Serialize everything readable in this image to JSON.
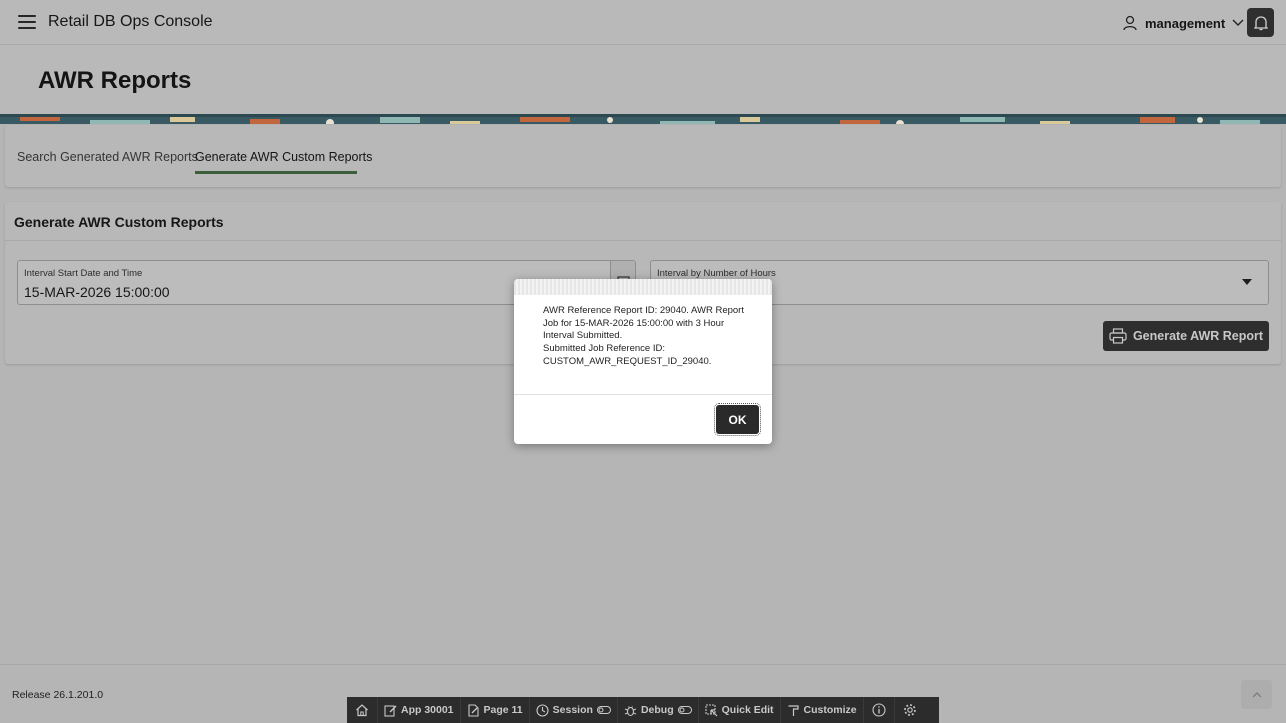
{
  "header": {
    "app_title": "Retail DB Ops Console",
    "user_name": "management",
    "menu_icon": "hamburger-menu-icon",
    "user_icon": "user-icon",
    "notification_icon": "bell-icon"
  },
  "page": {
    "title": "AWR Reports"
  },
  "tabs": [
    {
      "label": "Search Generated AWR Reports",
      "active": false
    },
    {
      "label": "Generate AWR Custom Reports",
      "active": true
    }
  ],
  "region": {
    "title": "Generate AWR Custom Reports",
    "start_field": {
      "label": "Interval Start Date and Time",
      "value": "15-MAR-2026 15:00:00"
    },
    "hours_field": {
      "label": "Interval by Number of Hours",
      "value": ""
    },
    "generate_button": "Generate AWR Report"
  },
  "dialog": {
    "message_line1": "AWR Reference Report ID: 29040. AWR Report Job for 15-MAR-2026 15:00:00 with 3 Hour Interval Submitted.",
    "message_line2": "Submitted Job Reference ID:",
    "message_line3": "CUSTOM_AWR_REQUEST_ID_29040.",
    "ok_label": "OK"
  },
  "footer": {
    "release": "Release 26.1.201.0"
  },
  "devbar": {
    "home_icon": "home-icon",
    "app": "App 30001",
    "page": "Page 11",
    "session": "Session",
    "debug": "Debug",
    "quick_edit": "Quick Edit",
    "customize": "Customize"
  },
  "colors": {
    "overlay_page": "#b8b8b8",
    "dark_button": "#2e2e2e",
    "tab_underline": "#3c5f3b"
  }
}
